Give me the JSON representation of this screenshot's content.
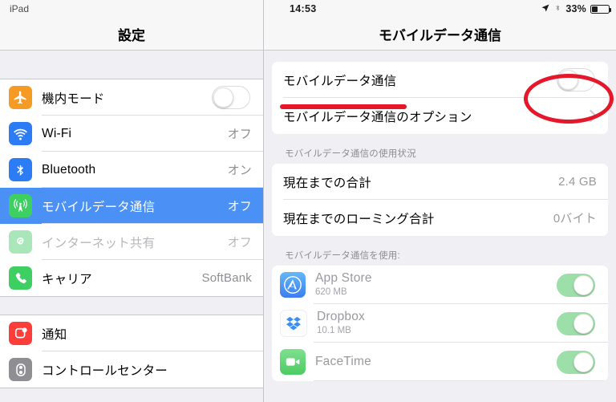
{
  "sidebar": {
    "device_label": "iPad",
    "title": "設定",
    "groups": [
      {
        "rows": [
          {
            "label": "機内モード",
            "icon": "airplane-icon",
            "icon_color": "#f59a23",
            "control": "toggle",
            "toggle_on": false,
            "value": "",
            "state": "normal"
          },
          {
            "label": "Wi-Fi",
            "icon": "wifi-icon",
            "icon_color": "#2c7cf6",
            "control": "value",
            "value": "オフ",
            "state": "normal"
          },
          {
            "label": "Bluetooth",
            "icon": "bluetooth-icon",
            "icon_color": "#2c7cf6",
            "control": "value",
            "value": "オン",
            "state": "normal"
          },
          {
            "label": "モバイルデータ通信",
            "icon": "cellular-icon",
            "icon_color": "#3ecf63",
            "control": "value",
            "value": "オフ",
            "state": "selected"
          },
          {
            "label": "インターネット共有",
            "icon": "personal-hotspot-icon",
            "icon_color": "#a9e7bb",
            "control": "value",
            "value": "オフ",
            "state": "disabled"
          },
          {
            "label": "キャリア",
            "icon": "phone-icon",
            "icon_color": "#3ecf63",
            "control": "value",
            "value": "SoftBank",
            "state": "normal"
          }
        ]
      },
      {
        "rows": [
          {
            "label": "通知",
            "icon": "notifications-icon",
            "icon_color": "#fc3d39",
            "control": "none",
            "value": "",
            "state": "normal"
          },
          {
            "label": "コントロールセンター",
            "icon": "control-center-icon",
            "icon_color": "#8e8e93",
            "control": "none",
            "value": "",
            "state": "normal"
          }
        ]
      }
    ]
  },
  "statusbar": {
    "time": "14:53",
    "location_icon": "location-arrow-icon",
    "bluetooth_icon": "bluetooth-status-icon",
    "battery_percent": "33%",
    "battery_level": 33
  },
  "panel": {
    "title": "モバイルデータ通信",
    "main_card": [
      {
        "label": "モバイルデータ通信",
        "control": "toggle",
        "toggle_on": false,
        "value": ""
      },
      {
        "label": "モバイルデータ通信のオプション",
        "control": "chevron",
        "value": ""
      }
    ],
    "usage_header": "モバイルデータ通信の使用状況",
    "usage_rows": [
      {
        "label": "現在までの合計",
        "value": "2.4 GB"
      },
      {
        "label": "現在までのローミング合計",
        "value": "0バイト"
      }
    ],
    "apps_header": "モバイルデータ通信を使用:",
    "apps": [
      {
        "name": "App Store",
        "size": "620 MB",
        "icon": "app-store-icon",
        "toggle_on": true
      },
      {
        "name": "Dropbox",
        "size": "10.1 MB",
        "icon": "dropbox-icon",
        "toggle_on": true
      },
      {
        "name": "FaceTime",
        "size": "",
        "icon": "facetime-icon",
        "toggle_on": true
      }
    ]
  },
  "annotations": {
    "color": "#e4172b",
    "underline_target": "モバイルデータ通信",
    "ellipse_target": "cellular-data-toggle"
  }
}
